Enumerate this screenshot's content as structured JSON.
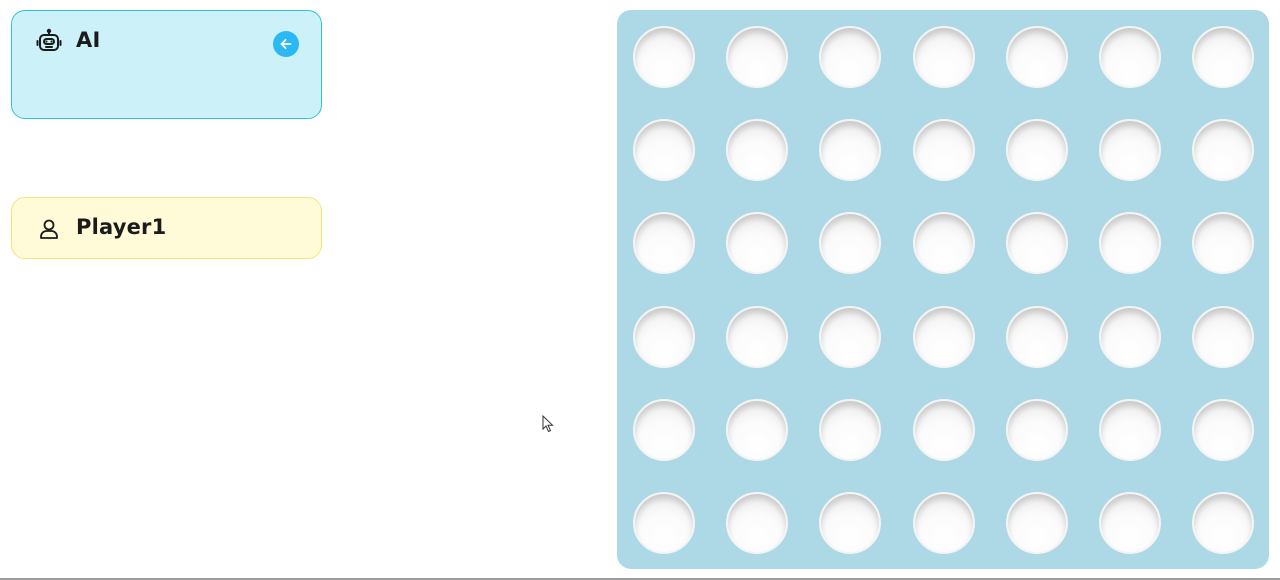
{
  "players": [
    {
      "name": "AI",
      "icon": "robot-icon",
      "accent": "#30c2dc",
      "background": "#cdf1f8",
      "active_turn": true
    },
    {
      "name": "Player1",
      "icon": "user-icon",
      "accent": "#f3e57a",
      "background": "#fffbd8",
      "active_turn": false
    }
  ],
  "turn_indicator": {
    "icon": "arrow-left-icon",
    "color": "#2bb8f3"
  },
  "board": {
    "rows": 6,
    "columns": 7,
    "background": "#add8e6",
    "cells": [
      [
        "empty",
        "empty",
        "empty",
        "empty",
        "empty",
        "empty",
        "empty"
      ],
      [
        "empty",
        "empty",
        "empty",
        "empty",
        "empty",
        "empty",
        "empty"
      ],
      [
        "empty",
        "empty",
        "empty",
        "empty",
        "empty",
        "empty",
        "empty"
      ],
      [
        "empty",
        "empty",
        "empty",
        "empty",
        "empty",
        "empty",
        "empty"
      ],
      [
        "empty",
        "empty",
        "empty",
        "empty",
        "empty",
        "empty",
        "empty"
      ],
      [
        "empty",
        "empty",
        "empty",
        "empty",
        "empty",
        "empty",
        "empty"
      ]
    ]
  }
}
